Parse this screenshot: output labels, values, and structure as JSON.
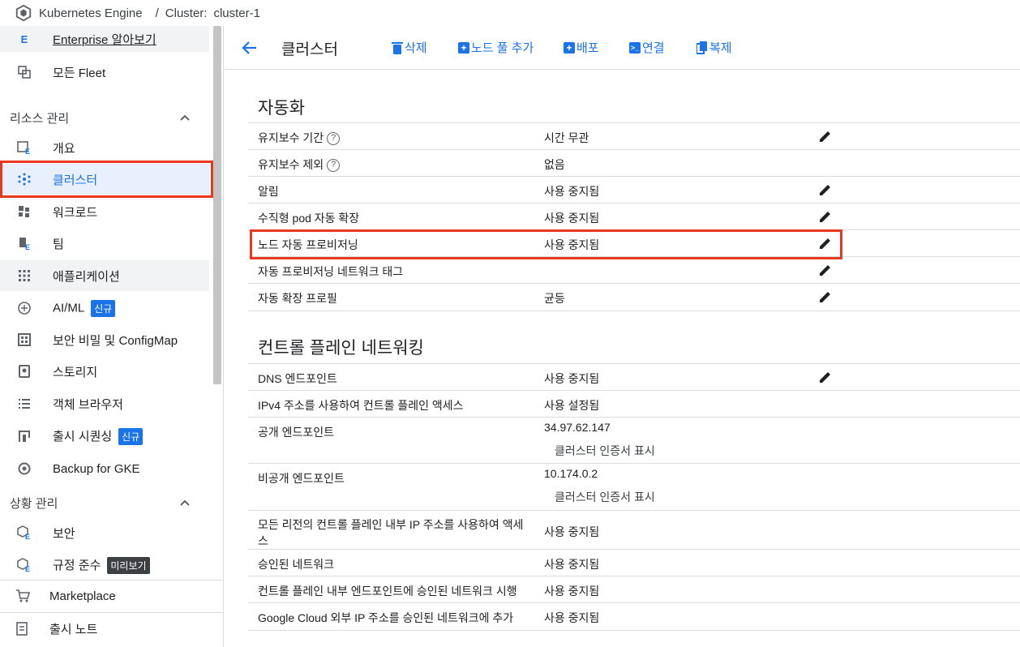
{
  "breadcrumb": {
    "product": "Kubernetes Engine",
    "sep": "/",
    "cluster_label": "Cluster:",
    "cluster_name": "cluster-1"
  },
  "sidebar": {
    "top_items": [
      {
        "label": "Enterprise 알아보기",
        "icon": "enterprise-icon"
      },
      {
        "label": "모든 Fleet",
        "icon": "fleet-icon"
      }
    ],
    "section_resources": "리소스 관리",
    "resource_items": [
      {
        "label": "개요",
        "icon": "overview-icon"
      },
      {
        "label": "클러스터",
        "icon": "clusters-icon"
      },
      {
        "label": "워크로드",
        "icon": "workloads-icon"
      },
      {
        "label": "팀",
        "icon": "teams-icon"
      },
      {
        "label": "애플리케이션",
        "icon": "applications-icon"
      },
      {
        "label": "AI/ML",
        "icon": "ai-ml-icon",
        "badge": "신규"
      },
      {
        "label": "보안 비밀 및 ConfigMap",
        "icon": "secrets-icon"
      },
      {
        "label": "스토리지",
        "icon": "storage-icon"
      },
      {
        "label": "객체 브라우저",
        "icon": "object-browser-icon"
      },
      {
        "label": "출시 시퀀싱",
        "icon": "rollout-sequencing-icon",
        "badge": "신규"
      },
      {
        "label": "Backup for GKE",
        "icon": "backup-icon"
      }
    ],
    "section_posture": "상황 관리",
    "posture_items": [
      {
        "label": "보안",
        "icon": "security-icon"
      },
      {
        "label": "규정 준수",
        "icon": "compliance-icon",
        "badge": "미리보기"
      }
    ],
    "bottom_items": [
      {
        "label": "Marketplace",
        "icon": "marketplace-icon"
      },
      {
        "label": "출시 노트",
        "icon": "release-notes-icon"
      }
    ]
  },
  "toolbar": {
    "title": "클러스터",
    "delete": "삭제",
    "add_node_pool": "노드 풀 추가",
    "deploy": "배포",
    "connect": "연결",
    "duplicate": "복제"
  },
  "automation": {
    "title": "자동화",
    "rows": [
      {
        "key": "유지보수 기간",
        "value": "시간 무관",
        "help": true,
        "edit": true
      },
      {
        "key": "유지보수 제외",
        "value": "없음",
        "help": true,
        "edit": false
      },
      {
        "key": "알림",
        "value": "사용 중지됨",
        "edit": true
      },
      {
        "key": "수직형 pod 자동 확장",
        "value": "사용 중지됨",
        "edit": true
      },
      {
        "key": "노드 자동 프로비저닝",
        "value": "사용 중지됨",
        "edit": true
      },
      {
        "key": "자동 프로비저닝 네트워크 태그",
        "value": "",
        "edit": true
      },
      {
        "key": "자동 확장 프로필",
        "value": "균등",
        "edit": true
      }
    ]
  },
  "networking": {
    "title": "컨트롤 플레인 네트워킹",
    "rows": [
      {
        "key": "DNS 엔드포인트",
        "value": "사용 중지됨",
        "edit": true
      },
      {
        "key": "IPv4 주소를 사용하여 컨트롤 플레인 액세스",
        "value": "사용 설정됨"
      },
      {
        "key": "공개 엔드포인트",
        "value": "34.97.62.147",
        "sub": "클러스터 인증서 표시"
      },
      {
        "key": "비공개 엔드포인트",
        "value": "10.174.0.2",
        "sub": "클러스터 인증서 표시"
      },
      {
        "key": "모든 리전의 컨트롤 플레인 내부 IP 주소를 사용하여 액세",
        "key2": "스",
        "value": "사용 중지됨"
      },
      {
        "key": "승인된 네트워크",
        "value": "사용 중지됨"
      },
      {
        "key": "컨트롤 플레인 내부 엔드포인트에 승인된 네트워크 시행",
        "value": "사용 중지됨"
      },
      {
        "key": "Google Cloud 외부 IP 주소를 승인된 네트워크에 추가",
        "value": "사용 중지됨"
      }
    ]
  },
  "colors": {
    "accent": "#1a73e8",
    "highlight": "#e8391e",
    "badge_new": "#1a73e8",
    "badge_preview": "#3c4043"
  }
}
